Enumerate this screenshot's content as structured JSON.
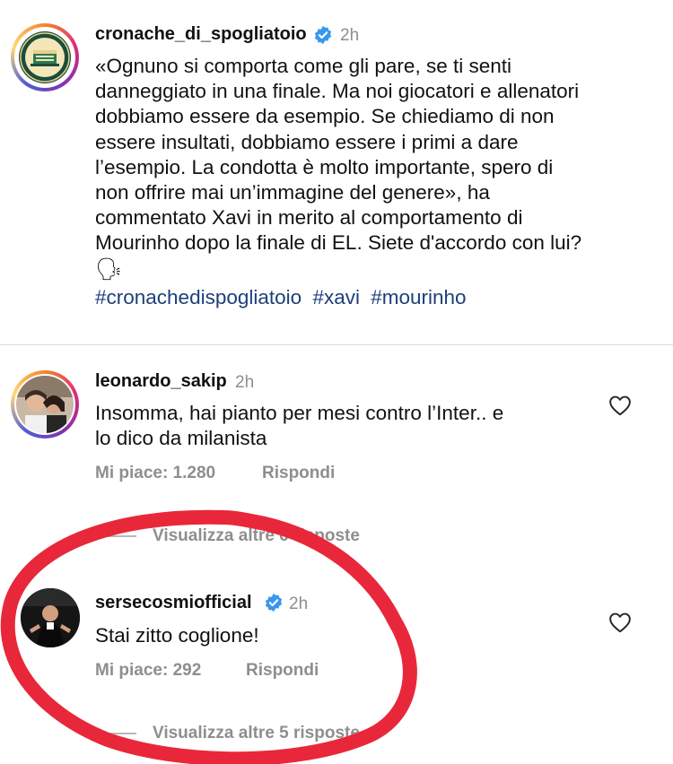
{
  "post": {
    "username": "cronache_di_spogliatoio",
    "time": "2h",
    "logo_text": "CRONACHE DI SPOGLIATOIO",
    "caption_lines": [
      "«Ognuno si comporta come gli pare, se ti senti",
      "danneggiato in una finale. Ma noi giocatori e allenatori",
      "dobbiamo essere da esempio. Se chiediamo di non",
      "essere insultati, dobbiamo essere i primi a dare",
      "l’esempio. La condotta è molto importante, spero di",
      "non offrire mai un’immagine del genere», ha",
      "commentato Xavi in merito al comportamento di",
      "Mourinho dopo la finale di EL. Siete d'accordo con lui?"
    ],
    "emoji": "🗣",
    "hashtags": [
      "#cronachedispogliatoio",
      "#xavi",
      "#mourinho"
    ]
  },
  "comments": [
    {
      "username": "leonardo_sakip",
      "time": "2h",
      "text_lines": [
        "Insomma, hai pianto per mesi contro l’Inter.. e",
        "lo dico da milanista"
      ],
      "likes": "Mi piace: 1.280",
      "reply": "Rispondi",
      "view_replies": "Visualizza altre 6 risposte"
    },
    {
      "username": "sersecosmiofficial",
      "time": "2h",
      "text_lines": [
        "Stai zitto coglione!"
      ],
      "likes": "Mi piace: 292",
      "reply": "Rispondi",
      "view_replies": "Visualizza altre 5 risposte"
    }
  ],
  "colors": {
    "verified": "#3897f0",
    "hashtag": "#1d3f7a",
    "secondary_text": "#8e8e8e",
    "annotation": "#e8283a"
  }
}
